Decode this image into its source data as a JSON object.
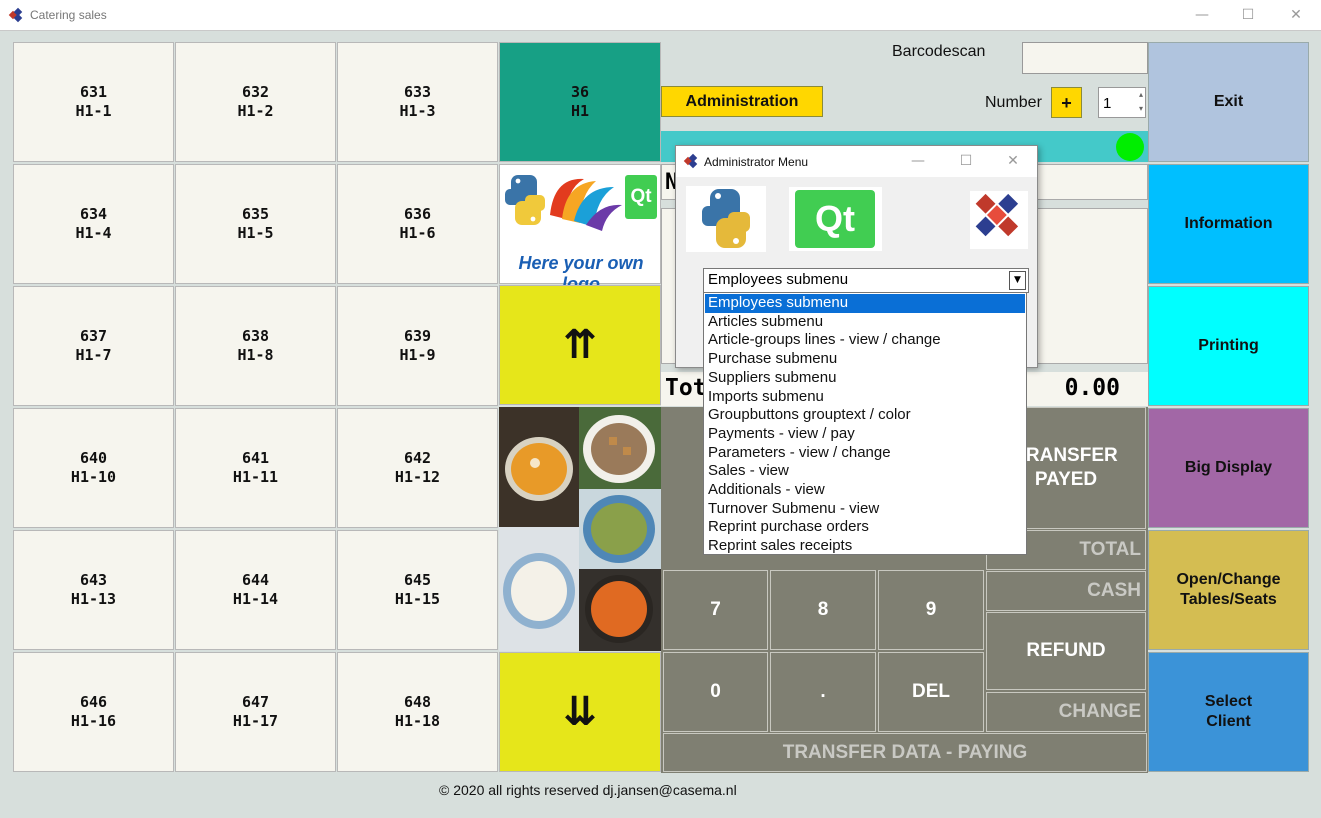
{
  "window": {
    "title": "Catering sales"
  },
  "tables": [
    {
      "num": "631",
      "name": "H1-1"
    },
    {
      "num": "632",
      "name": "H1-2"
    },
    {
      "num": "633",
      "name": "H1-3"
    },
    {
      "num": "634",
      "name": "H1-4"
    },
    {
      "num": "635",
      "name": "H1-5"
    },
    {
      "num": "636",
      "name": "H1-6"
    },
    {
      "num": "637",
      "name": "H1-7"
    },
    {
      "num": "638",
      "name": "H1-8"
    },
    {
      "num": "639",
      "name": "H1-9"
    },
    {
      "num": "640",
      "name": "H1-10"
    },
    {
      "num": "641",
      "name": "H1-11"
    },
    {
      "num": "642",
      "name": "H1-12"
    },
    {
      "num": "643",
      "name": "H1-13"
    },
    {
      "num": "644",
      "name": "H1-14"
    },
    {
      "num": "645",
      "name": "H1-15"
    },
    {
      "num": "646",
      "name": "H1-16"
    },
    {
      "num": "647",
      "name": "H1-17"
    },
    {
      "num": "648",
      "name": "H1-18"
    }
  ],
  "group": {
    "num": "36",
    "name": "H1",
    "color": "#17a085"
  },
  "logo": {
    "text": "Here your own logo"
  },
  "scroll": {
    "up": "⇈",
    "down": "⇊"
  },
  "barcode": {
    "label": "Barcodescan",
    "value": ""
  },
  "administration": {
    "label": "Administration"
  },
  "number": {
    "label": "Number",
    "plus": "+",
    "value": "1"
  },
  "order": {
    "total_label_partial": "Tot",
    "total_value": "0.00",
    "header_partial": "N"
  },
  "keypad": {
    "k7": "7",
    "k8": "8",
    "k9": "9",
    "k0": "0",
    "kdot": ".",
    "kdel": "DEL",
    "transfer_payed": "TRANSFER PAYED",
    "refund": "REFUND",
    "total": "TOTAL",
    "cash": "CASH",
    "change": "CHANGE",
    "transfer_data": "TRANSFER DATA - PAYING"
  },
  "right_menu": {
    "exit": "Exit",
    "information": "Information",
    "printing": "Printing",
    "big_display": "Big Display",
    "open_change": "Open/Change Tables/Seats",
    "select_client": "Select Client"
  },
  "footer": {
    "copyright": "© 2020 all rights reserved dj.jansen@casema.nl"
  },
  "admin_dialog": {
    "title": "Administrator Menu",
    "selected": "Employees submenu",
    "items": [
      "Employees submenu",
      "Articles submenu",
      "Article-groups lines - view / change",
      "Purchase submenu",
      "Suppliers submenu",
      "Imports submenu",
      "Groupbuttons grouptext / color",
      "Payments - view / pay",
      "Parameters - view / change",
      "Sales - view",
      "Additionals - view",
      "Turnover Submenu - view",
      "Reprint purchase orders",
      "Reprint sales receipts"
    ]
  },
  "colors": {
    "exit": "#b0c4de",
    "information": "#00bfff",
    "printing": "#00ffff",
    "big_display": "#a267a6",
    "open_change": "#d4bd52",
    "select_client": "#3b93d8",
    "administration": "#ffd700",
    "status_bar": "#44c9c9",
    "status_dot": "#00ee00",
    "keypad": "#7f7f72"
  }
}
